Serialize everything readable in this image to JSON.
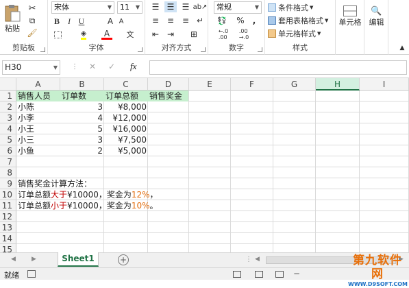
{
  "ribbon": {
    "clipboard": {
      "paste_label": "粘贴",
      "group_label": "剪贴板"
    },
    "font": {
      "font_name": "宋体",
      "font_size": "11",
      "bold": "B",
      "italic": "I",
      "underline": "U",
      "font_color_glyph": "A",
      "grow": "A",
      "shrink": "A",
      "wen": "文",
      "group_label": "字体"
    },
    "alignment": {
      "group_label": "对齐方式"
    },
    "number": {
      "format": "常规",
      "percent": "%",
      "comma": ",",
      "group_label": "数字"
    },
    "styles": {
      "conditional": "条件格式",
      "table": "套用表格格式",
      "cell_styles": "单元格样式",
      "group_label": "样式"
    },
    "cells": {
      "label": "单元格"
    },
    "editing": {
      "label": "编辑"
    }
  },
  "formula_bar": {
    "name_box": "H30",
    "fx": "fx",
    "formula": ""
  },
  "sheet": {
    "columns": [
      "A",
      "B",
      "C",
      "D",
      "E",
      "F",
      "G",
      "H",
      "I"
    ],
    "selected_column": "H",
    "rows": [
      "1",
      "2",
      "3",
      "4",
      "5",
      "6",
      "7",
      "8",
      "9",
      "10",
      "11",
      "12",
      "13",
      "14",
      "15"
    ],
    "header": {
      "a": "销售人员",
      "b": "订单数",
      "c": "订单总额",
      "d": "销售奖金"
    },
    "data": [
      {
        "name": "小陈",
        "orders": "3",
        "total": "¥8,000"
      },
      {
        "name": "小李",
        "orders": "4",
        "total": "¥12,000"
      },
      {
        "name": "小王",
        "orders": "5",
        "total": "¥16,000"
      },
      {
        "name": "小三",
        "orders": "3",
        "total": "¥7,500"
      },
      {
        "name": "小鱼",
        "orders": "2",
        "total": "¥5,000"
      }
    ],
    "note_title": "销售奖金计算方法：",
    "note1": {
      "p1": "订单总额",
      "op": "大于",
      "p2": "¥10000，奖金为",
      "pct": "12%",
      "end": "，"
    },
    "note2": {
      "p1": "订单总额",
      "op": "小于",
      "p2": "¥10000，奖金为",
      "pct": "10%",
      "end": "。"
    },
    "colors": {
      "header_fill": "#c6efce",
      "op_red": "#c00000",
      "pct_orange": "#e26b0a"
    }
  },
  "tabs": {
    "sheet1": "Sheet1",
    "add": "+"
  },
  "status": {
    "ready": "就绪"
  },
  "watermark": {
    "text": "第九软件网",
    "url": "WWW.D9SOFT.COM"
  }
}
